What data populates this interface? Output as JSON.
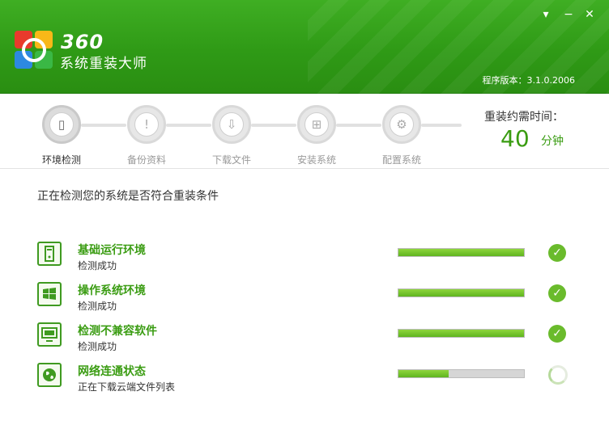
{
  "header": {
    "brand_num": "360",
    "brand_name": "系统重装大师",
    "version": "程序版本：3.1.0.2006",
    "menu_icon": "menu-dropdown-icon",
    "min_icon": "minimize-icon",
    "close_icon": "close-icon"
  },
  "steps": [
    {
      "label": "环境检测",
      "icon": "computer-check-icon",
      "active": true
    },
    {
      "label": "备份资料",
      "icon": "backup-icon",
      "active": false
    },
    {
      "label": "下载文件",
      "icon": "download-icon",
      "active": false
    },
    {
      "label": "安装系统",
      "icon": "install-icon",
      "active": false
    },
    {
      "label": "配置系统",
      "icon": "configure-icon",
      "active": false
    }
  ],
  "time": {
    "label": "重装约需时间：",
    "value": "40",
    "unit": "分钟"
  },
  "main": {
    "title": "正在检测您的系统是否符合重装条件"
  },
  "checks": [
    {
      "name": "基础运行环境",
      "status": "检测成功",
      "progress": 1.0,
      "state": "done",
      "icon": "pc-tower-icon"
    },
    {
      "name": "操作系统环境",
      "status": "检测成功",
      "progress": 1.0,
      "state": "done",
      "icon": "windows-logo-icon"
    },
    {
      "name": "检测不兼容软件",
      "status": "检测成功",
      "progress": 1.0,
      "state": "done",
      "icon": "monitor-icon"
    },
    {
      "name": "网络连通状态",
      "status": "正在下载云端文件列表",
      "progress": 0.4,
      "state": "loading",
      "icon": "globe-icon"
    }
  ],
  "colors": {
    "accent": "#3a9c12",
    "header": "#2f9a16",
    "progress_fill": "#6abb2c"
  }
}
